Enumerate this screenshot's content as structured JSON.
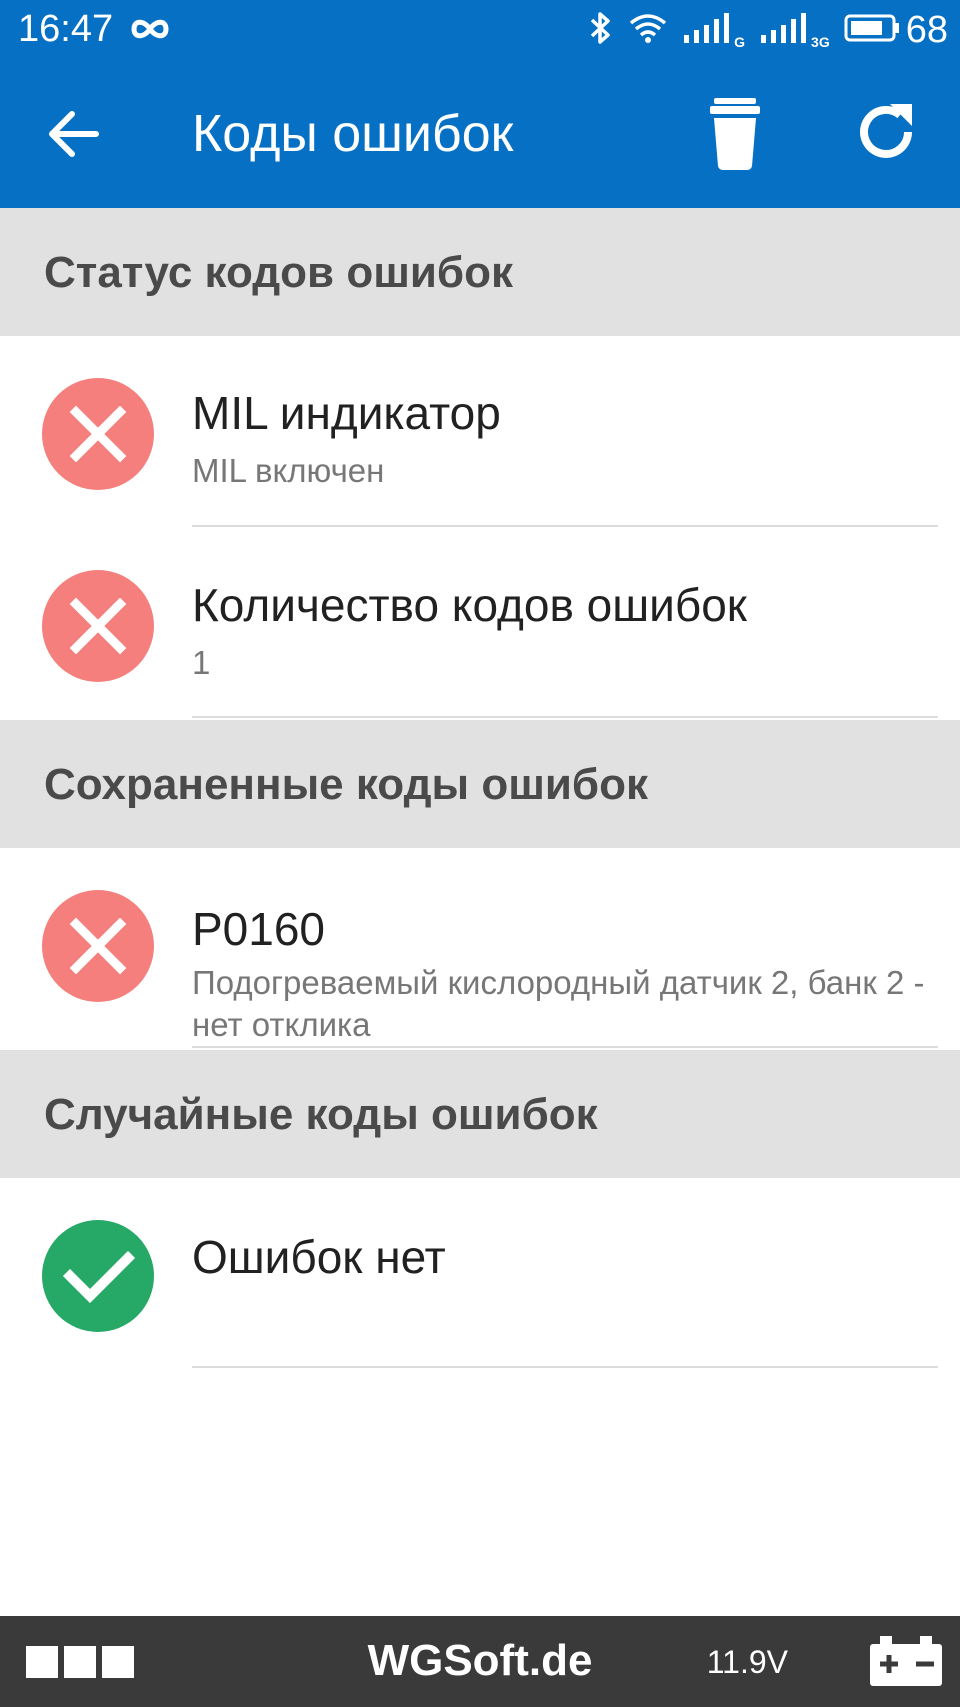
{
  "status_bar": {
    "time": "16:47",
    "net1": "G",
    "net2": "3G",
    "battery": "68",
    "icons": [
      "infinity-icon",
      "bluetooth-icon",
      "wifi-icon",
      "signal-icon",
      "signal-icon",
      "battery-icon"
    ]
  },
  "app_bar": {
    "title": "Коды ошибок",
    "icons": [
      "back-arrow-icon",
      "trash-icon",
      "refresh-icon"
    ]
  },
  "sections": [
    {
      "title": "Статус кодов ошибок",
      "items": [
        {
          "status": "error",
          "title": "MIL индикатор",
          "subtitle": "MIL включен"
        },
        {
          "status": "error",
          "title": "Количество кодов ошибок",
          "subtitle": "1"
        }
      ]
    },
    {
      "title": "Сохраненные коды ошибок",
      "items": [
        {
          "status": "error",
          "title": "P0160",
          "subtitle": "Подогреваемый кислородный датчик 2, банк 2 - нет отклика"
        }
      ]
    },
    {
      "title": "Случайные коды ошибок",
      "items": [
        {
          "status": "ok",
          "title": "Ошибок нет",
          "subtitle": ""
        }
      ]
    }
  ],
  "bottom_bar": {
    "brand": "WGSoft.de",
    "voltage": "11.9V"
  },
  "colors": {
    "primary": "#0670c5",
    "error": "#f47f7c",
    "ok": "#26a866",
    "section_bg": "#e1e1e1",
    "bottom_bg": "#3a3a3a"
  }
}
